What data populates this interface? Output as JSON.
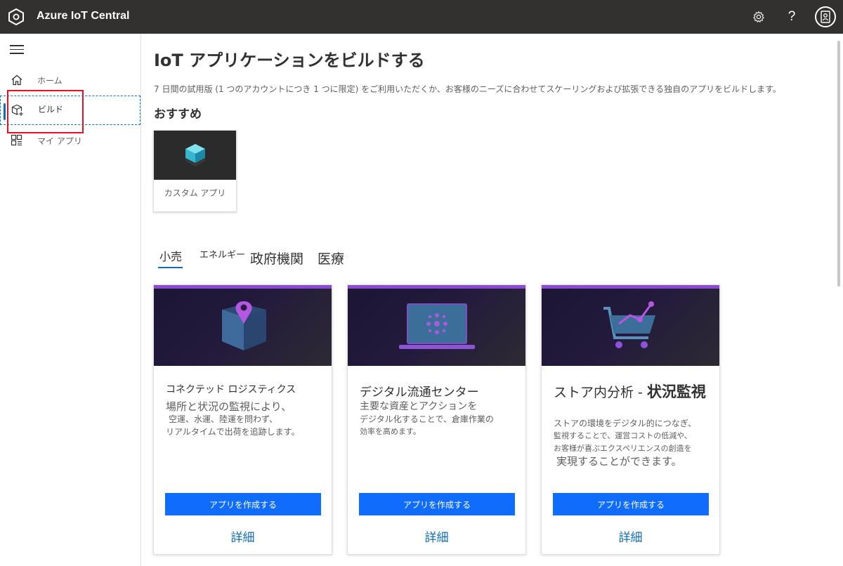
{
  "header": {
    "app_title": "Azure IoT Central"
  },
  "icons": {
    "logo": "azure-iot-logo-icon",
    "settings": "gear-icon",
    "help": "help-icon",
    "account": "avatar-icon"
  },
  "help_glyph": "?",
  "sidebar": {
    "items": [
      {
        "label": "ホーム",
        "icon": "home-icon"
      },
      {
        "label": "ビルド",
        "icon": "build-icon",
        "active": true
      },
      {
        "label": "マイ アプリ",
        "icon": "my-apps-icon"
      }
    ]
  },
  "main": {
    "title": "IoT アプリケーションをビルドする",
    "description": "7 日間の試用版 (1 つのアカウントにつき 1 つに限定) をご利用いただくか、お客様のニーズに合わせてスケーリングおよび拡張できる独自のアプリをビルドします。",
    "featured_heading": "おすすめ",
    "featured_card": {
      "label": "カスタム アプリ"
    },
    "tabs": [
      {
        "label": "小売",
        "selected": true
      },
      {
        "label": "エネルギー"
      },
      {
        "label": "政府機関"
      },
      {
        "label": "医療"
      }
    ],
    "cards": [
      {
        "title": "コネクテッド ロジスティクス",
        "lines": [
          "場所と状況の監視により、",
          "空運、水運、陸運を問わず、",
          "リアルタイムで出荷を追跡します。"
        ],
        "button": "アプリを作成する",
        "link": "詳細"
      },
      {
        "title": "デジタル流通センター",
        "lines": [
          "主要な資産とアクションを",
          "デジタル化することで、倉庫作業の",
          "効率を高めます。"
        ],
        "button": "アプリを作成する",
        "link": "詳細"
      },
      {
        "title_part1": "ストア内分析 - ",
        "title_part2": "状況監視",
        "lines": [
          "ストアの環境をデジタル的につなぎ、",
          "監視することで、運営コストの低減や、",
          "お客様が喜ぶエクスペリエンスの創造を",
          "実現することができます。"
        ],
        "button": "アプリを作成する",
        "link": "詳細"
      }
    ]
  },
  "colors": {
    "topbar": "#323130",
    "accent": "#0f6cbd",
    "button": "#0f6cfd",
    "card_stripe": "#8a4bd1",
    "highlight": "#e81123"
  }
}
